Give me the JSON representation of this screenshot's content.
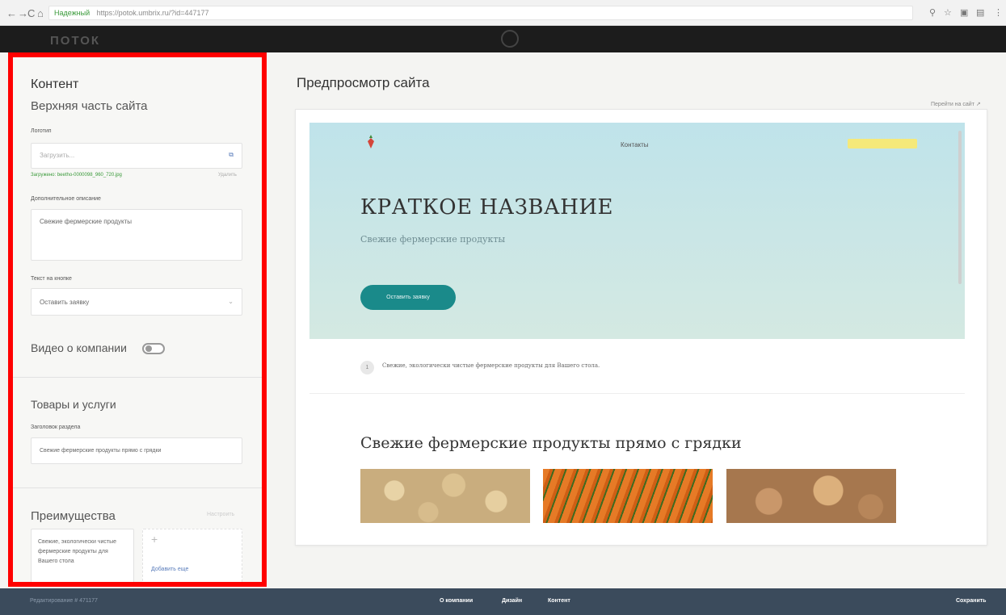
{
  "browser": {
    "back": "←",
    "forward": "→",
    "reload": "C",
    "home": "⌂",
    "secure_label": "Надежный",
    "url": "https://potok.umbrix.ru/?id=447177"
  },
  "app": {
    "logo": "ПОТОК"
  },
  "left_panel": {
    "content_title": "Контент",
    "top_section": {
      "title": "Верхняя часть сайта",
      "logo_label": "Логотип",
      "logo_placeholder": "Загрузить...",
      "uploaded_text": "Загружено: beetho-0000098_960_720.jpg",
      "remove_label": "Удалить",
      "description_label": "Дополнительное описание",
      "description_value": "Свежие фермерские продукты",
      "button_text_label": "Текст на кнопке",
      "button_text_value": "Оставить заявку"
    },
    "video_toggle_label": "Видео о компании",
    "goods_section": {
      "title": "Товары и услуги",
      "heading_label": "Заголовок раздела",
      "heading_value": "Свежие фермерские продукты прямо с грядки"
    },
    "advantages": {
      "title": "Преимущества",
      "extra_label": "Настроить",
      "card_text": "Свежие, экологически чистые фермерские продукты для Вашего стола",
      "add_plus": "+",
      "add_label": "Добавить еще"
    }
  },
  "preview": {
    "title": "Предпросмотр сайта",
    "open_site": "Перейти на сайт ↗",
    "site": {
      "nav_contacts": "Контакты",
      "hero_title": "КРАТКОЕ НАЗВАНИЕ",
      "hero_subtitle": "Свежие фермерские продукты",
      "hero_button": "Оставить заявку",
      "feature_number": "1",
      "feature_text": "Свежие, экологически чистые фермерские продукты для Вашего стола.",
      "products_title": "Свежие фермерские продукты прямо с грядки"
    }
  },
  "bottom_bar": {
    "left_text": "Редактирование # 471177",
    "tabs": [
      "О компании",
      "Дизайн",
      "Контент"
    ],
    "save": "Сохранить"
  },
  "colors": {
    "highlight_border": "#ff0000",
    "accent_button": "#1a8a8a",
    "bottom_bar": "#3b4b5c"
  }
}
